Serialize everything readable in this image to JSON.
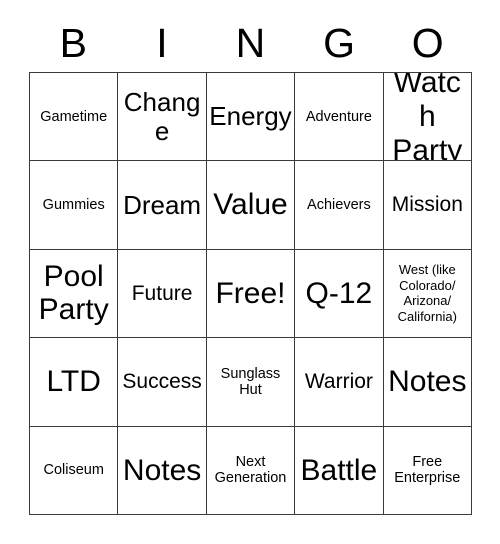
{
  "card": {
    "title": "BINGO",
    "header_letters": [
      "B",
      "I",
      "N",
      "G",
      "O"
    ],
    "columns": 5,
    "rows": 5,
    "border_color": "#3a3a3a",
    "background_color": "#ffffff",
    "text_color": "#000000",
    "free_space": "Free!",
    "cells": [
      {
        "text": "Gametime",
        "size": "sm"
      },
      {
        "text": "Change",
        "size": "lg"
      },
      {
        "text": "Energy",
        "size": "lg"
      },
      {
        "text": "Adventure",
        "size": "sm"
      },
      {
        "text": "Watch Party",
        "size": "xl"
      },
      {
        "text": "Gummies",
        "size": "sm"
      },
      {
        "text": "Dream",
        "size": "lg"
      },
      {
        "text": "Value",
        "size": "xl"
      },
      {
        "text": "Achievers",
        "size": "sm"
      },
      {
        "text": "Mission",
        "size": "md"
      },
      {
        "text": "Pool Party",
        "size": "xl"
      },
      {
        "text": "Future",
        "size": "md"
      },
      {
        "text": "Free!",
        "size": "xl"
      },
      {
        "text": "Q-12",
        "size": "xl"
      },
      {
        "text": "West (like Colorado/ Arizona/ California)",
        "size": "xs"
      },
      {
        "text": "LTD",
        "size": "xl"
      },
      {
        "text": "Success",
        "size": "md"
      },
      {
        "text": "Sunglass Hut",
        "size": "sm"
      },
      {
        "text": "Warrior",
        "size": "md"
      },
      {
        "text": "Notes",
        "size": "xl"
      },
      {
        "text": "Coliseum",
        "size": "sm"
      },
      {
        "text": "Notes",
        "size": "xl"
      },
      {
        "text": "Next Generation",
        "size": "sm"
      },
      {
        "text": "Battle",
        "size": "xl"
      },
      {
        "text": "Free Enterprise",
        "size": "sm"
      }
    ]
  }
}
